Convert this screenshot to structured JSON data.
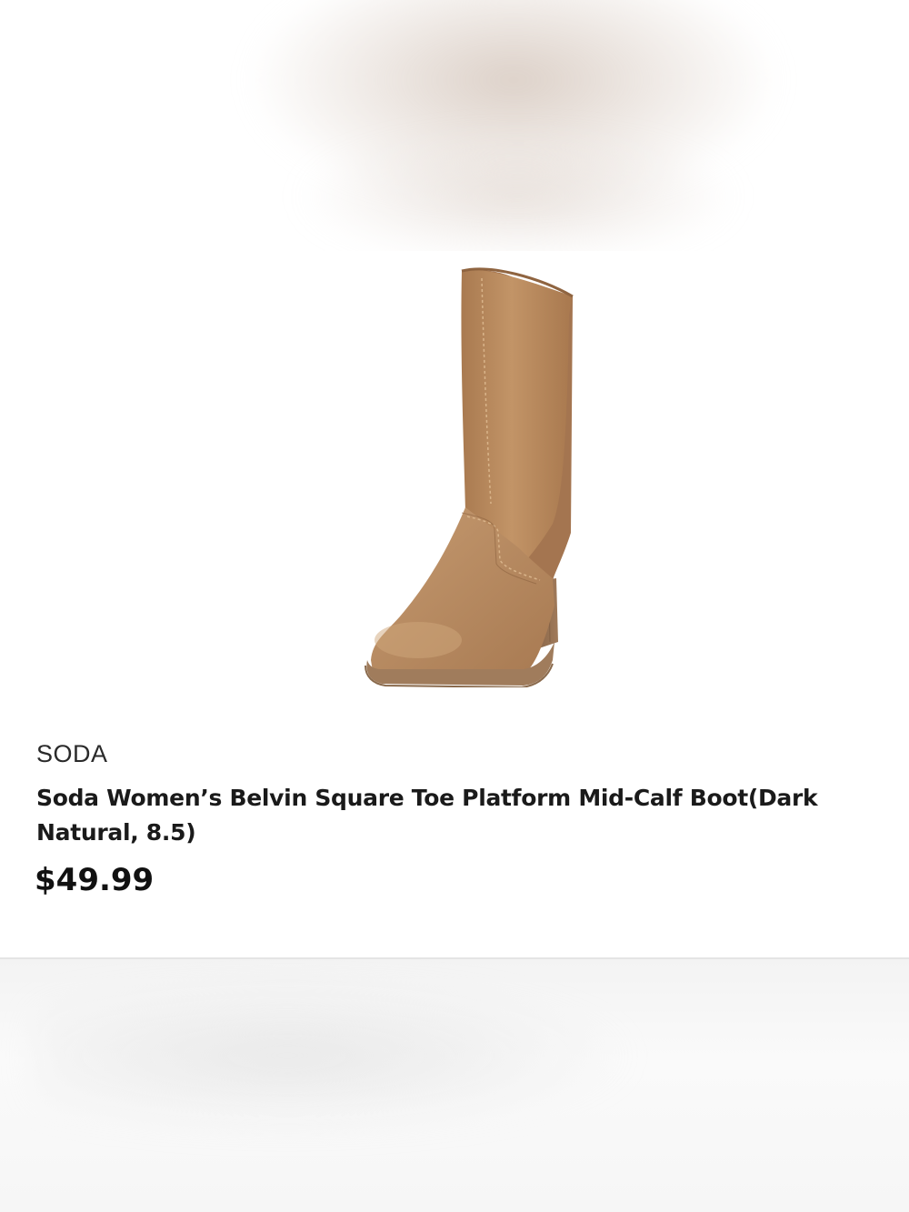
{
  "product": {
    "brand": "SODA",
    "title": "Soda Women’s Belvin  Square Toe Platform Mid-Calf Boot(Dark Natural, 8.5)",
    "price": "$49.99",
    "image_icon": "boot-image"
  },
  "colors": {
    "boot_main": "#b8875b",
    "boot_shadow": "#9a6c44",
    "boot_sole": "#a98462",
    "heel": "#8a6546",
    "text": "#1a1a1a"
  }
}
